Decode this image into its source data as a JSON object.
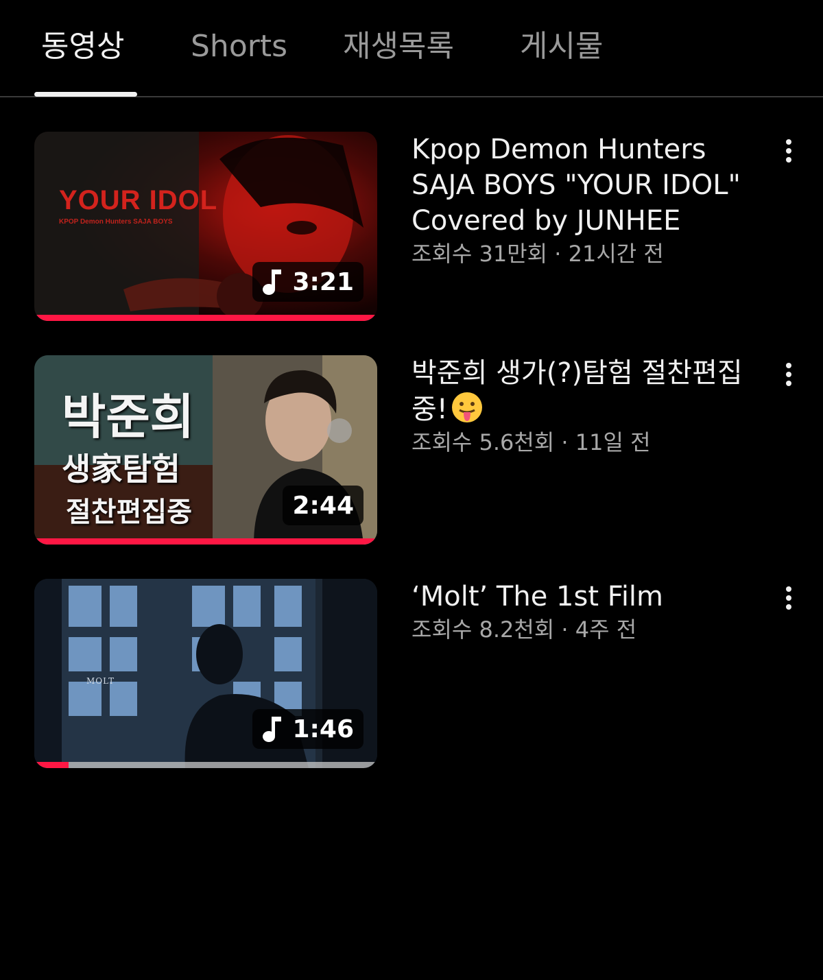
{
  "tabs": [
    {
      "label": "동영상",
      "active": true
    },
    {
      "label": "Shorts",
      "active": false
    },
    {
      "label": "재생목록",
      "active": false
    },
    {
      "label": "게시물",
      "active": false
    }
  ],
  "videos": [
    {
      "title": "Kpop Demon Hunters SAJA BOYS \"YOUR IDOL\" Covered by JUNHEE",
      "stats": "조회수 31만회 · 21시간 전",
      "duration": "3:21",
      "has_music_icon": true,
      "watched_fraction": 1.0,
      "thumb_text": {
        "main": "YOUR IDOL",
        "sub": "KPOP Demon Hunters SAJA BOYS"
      }
    },
    {
      "title": "박준희 생가(?)탐험 절찬편집중!",
      "title_emoji": "face-with-tongue-emoji",
      "stats": "조회수 5.6천회 · 11일 전",
      "duration": "2:44",
      "has_music_icon": false,
      "watched_fraction": 1.0,
      "thumb_text": {
        "line1": "박준희",
        "line2": "생家탐험",
        "line3": "절찬편집중"
      }
    },
    {
      "title": "‘Molt’ The 1st Film",
      "stats": "조회수 8.2천회 · 4주 전",
      "duration": "1:46",
      "has_music_icon": true,
      "watched_fraction": 0.1,
      "thumb_text": {
        "label": "MOLT"
      }
    }
  ],
  "colors": {
    "background": "#000000",
    "progress": "#ff1744",
    "text_primary": "#f1f1f1",
    "text_secondary": "#a8a8a8"
  }
}
